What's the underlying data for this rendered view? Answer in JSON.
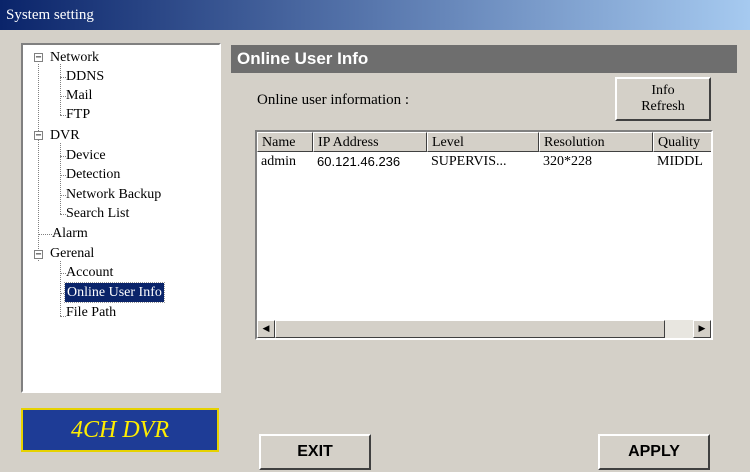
{
  "window": {
    "title": "System setting"
  },
  "tree": {
    "network": "Network",
    "ddns": "DDNS",
    "mail": "Mail",
    "ftp": "FTP",
    "dvr": "DVR",
    "device": "Device",
    "detection": "Detection",
    "network_backup": "Network Backup",
    "search_list": "Search List",
    "alarm": "Alarm",
    "general": "Gerenal",
    "account": "Account",
    "online_user_info": "Online User Info",
    "file_path": "File Path",
    "expander_symbol": "−"
  },
  "brand": {
    "label": "4CH DVR"
  },
  "panel": {
    "title": "Online User Info",
    "label": "Online user information :",
    "refresh_line1": "Info",
    "refresh_line2": "Refresh"
  },
  "table": {
    "columns": [
      "Name",
      "IP Address",
      "Level",
      "Resolution",
      "Quality"
    ],
    "rows": [
      [
        "admin",
        "60.121.46.236",
        "SUPERVIS...",
        "320*228",
        "MIDDL"
      ]
    ]
  },
  "scrollbar": {
    "left_arrow": "◀",
    "right_arrow": "▶"
  },
  "buttons": {
    "exit": "EXIT",
    "apply": "APPLY"
  }
}
